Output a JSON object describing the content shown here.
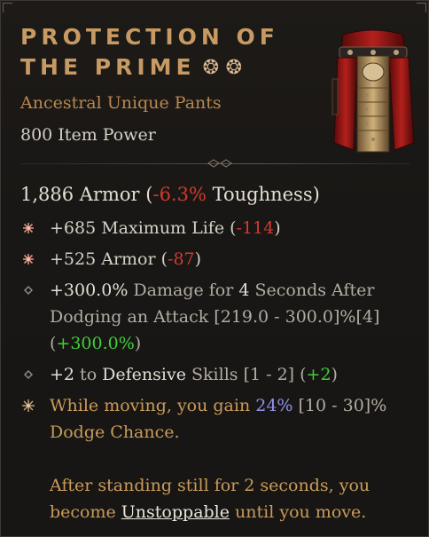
{
  "item": {
    "name_line1": "PROTECTION OF",
    "name_line2": "THE PRIME",
    "ancestral_marks": "❂ ❂",
    "type": "Ancestral Unique Pants",
    "item_power": "800 Item Power",
    "armor": {
      "value": "1,886 Armor",
      "open": " (",
      "toughness_change": "-6.3%",
      "toughness_label": " Toughness)"
    },
    "affixes": [
      {
        "text": "+685 Maximum Life",
        "open": " (",
        "delta": "-114",
        "close": ")"
      },
      {
        "text": "+525 Armor",
        "open": " (",
        "delta": "-87",
        "close": ")"
      }
    ],
    "aspect1": {
      "value": "+300.0%",
      "label_a": " Damage for ",
      "duration": "4",
      "label_b": " Seconds After Dodging an Attack ",
      "range": "[219.0 - 300.0]%[4]",
      "open": " (",
      "delta": "+300.0%",
      "close": ")"
    },
    "aspect2": {
      "value": "+2",
      "label_a": " to ",
      "skill": "Defensive",
      "label_b": " Skills ",
      "range": "[1 - 2]",
      "open": " (",
      "delta": "+2",
      "close": ")"
    },
    "unique_power": {
      "part1": "While moving, you gain ",
      "value": "24%",
      "range": " [10 - 30]%",
      "part2": " Dodge Chance.",
      "para2_a": "After standing still for 2 seconds, you become ",
      "keyword": "Unstoppable",
      "para2_b": " until you move."
    }
  },
  "colors": {
    "title": "#c79a63",
    "unique_type": "#b9874f",
    "negative": "#d23a2e",
    "positive": "#3fce3a",
    "highlight_blue": "#8f93e8",
    "unique_power": "#c99b5a"
  },
  "icons": [
    "ancestral-mark-icon",
    "affix-star-icon",
    "affix-diamond-icon",
    "unique-star-icon",
    "pants-item-image"
  ]
}
